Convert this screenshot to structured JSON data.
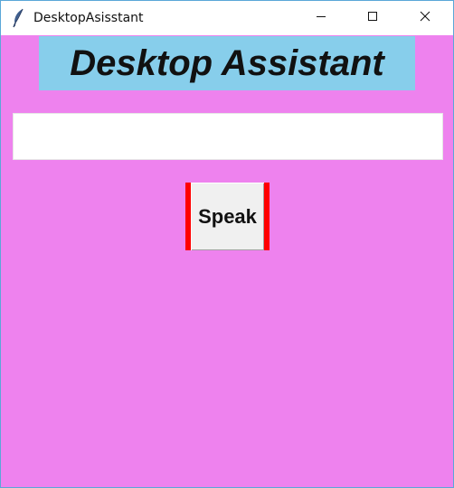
{
  "window": {
    "title": "DesktopAsisstant",
    "app_icon": "feather-icon",
    "controls": {
      "minimize_icon": "minimize-icon",
      "maximize_icon": "maximize-icon",
      "close_icon": "close-icon"
    }
  },
  "main": {
    "heading": "Desktop Assistant",
    "query_input": {
      "value": "",
      "placeholder": ""
    },
    "speak_button": {
      "label": "Speak"
    }
  },
  "colors": {
    "background": "#ee82ee",
    "heading_background": "#87ceeb",
    "button_border": "#ff0000",
    "button_face": "#f0f0f0"
  }
}
